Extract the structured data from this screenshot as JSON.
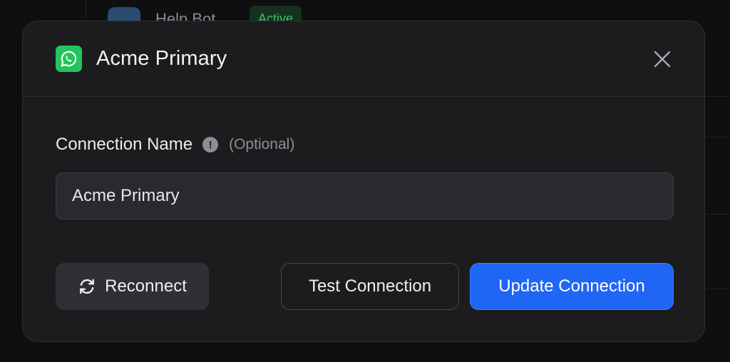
{
  "background": {
    "row_name": "Help Bot",
    "row_badge": "Active"
  },
  "modal": {
    "title": "Acme Primary",
    "icon": "whatsapp-icon",
    "close_icon": "close-icon",
    "field": {
      "label": "Connection Name",
      "optional_label": "(Optional)",
      "value": "Acme Primary",
      "info_icon": "info-icon"
    },
    "buttons": {
      "reconnect_label": "Reconnect",
      "test_label": "Test Connection",
      "update_label": "Update Connection"
    }
  },
  "colors": {
    "accent": "#1f66f5",
    "whatsapp_green": "#22c55e",
    "modal_bg": "#1c1c1f",
    "page_bg": "#0f0f11"
  }
}
